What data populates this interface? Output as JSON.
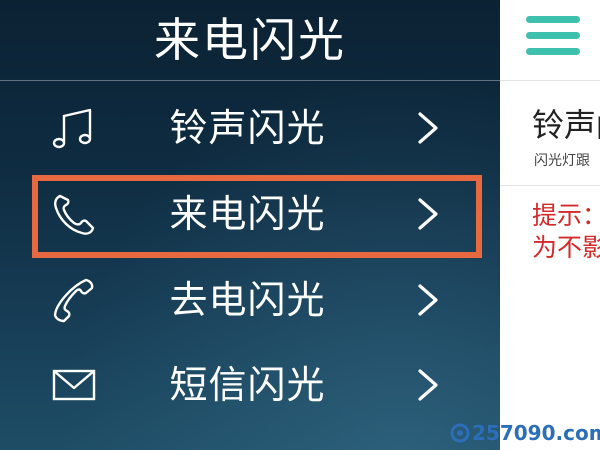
{
  "drawer": {
    "title": "来电闪光",
    "items": [
      {
        "label": "铃声闪光",
        "icon": "music-note-icon",
        "selected": false
      },
      {
        "label": "来电闪光",
        "icon": "phone-incoming-icon",
        "selected": true
      },
      {
        "label": "去电闪光",
        "icon": "phone-outgoing-icon",
        "selected": false
      },
      {
        "label": "短信闪光",
        "icon": "envelope-icon",
        "selected": false
      }
    ],
    "chevron_icon": "chevron-right-icon",
    "highlight_color": "#e8683f"
  },
  "content": {
    "menu_icon": "hamburger-menu-icon",
    "heading": "铃声闪",
    "subtitle": "闪光灯跟",
    "tip_line1": "提示：",
    "tip_line2": "为不影",
    "accent_color": "#3fbfae",
    "tip_color": "#d42a2a"
  },
  "watermark": {
    "text": "257090.com"
  }
}
